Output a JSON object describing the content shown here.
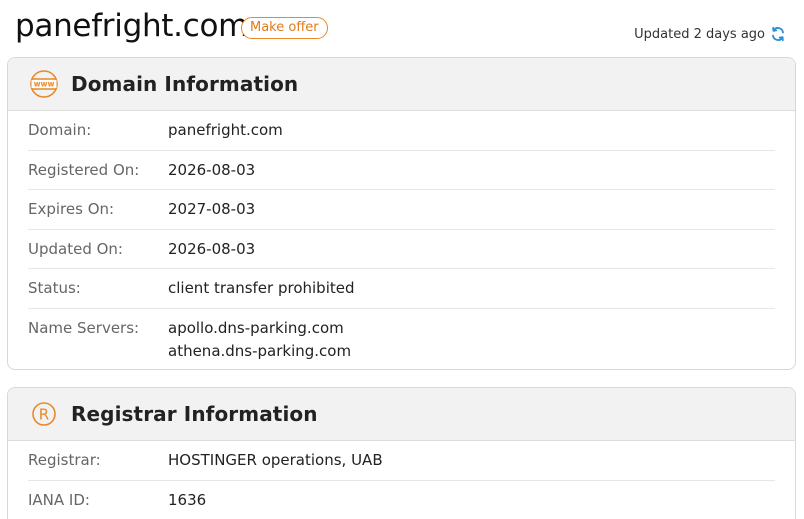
{
  "header": {
    "domain": "panefright.com",
    "make_offer": "Make offer",
    "updated": "Updated 2 days ago"
  },
  "domain_info": {
    "title": "Domain Information",
    "icon": "www-globe-icon",
    "rows": [
      {
        "label": "Domain:",
        "value": "panefright.com"
      },
      {
        "label": "Registered On:",
        "value": "2026-08-03"
      },
      {
        "label": "Expires On:",
        "value": "2027-08-03"
      },
      {
        "label": "Updated On:",
        "value": "2026-08-03"
      },
      {
        "label": "Status:",
        "value": "client transfer prohibited"
      },
      {
        "label": "Name Servers:",
        "values": [
          "apollo.dns-parking.com",
          "athena.dns-parking.com"
        ]
      }
    ]
  },
  "registrar_info": {
    "title": "Registrar Information",
    "icon": "registered-icon",
    "rows": [
      {
        "label": "Registrar:",
        "value": "HOSTINGER operations, UAB"
      },
      {
        "label": "IANA ID:",
        "value": "1636"
      }
    ]
  },
  "colors": {
    "accent": "#e8892b",
    "refresh": "#2a8fd6",
    "header_bg": "#f2f2f2",
    "label": "#666666"
  }
}
